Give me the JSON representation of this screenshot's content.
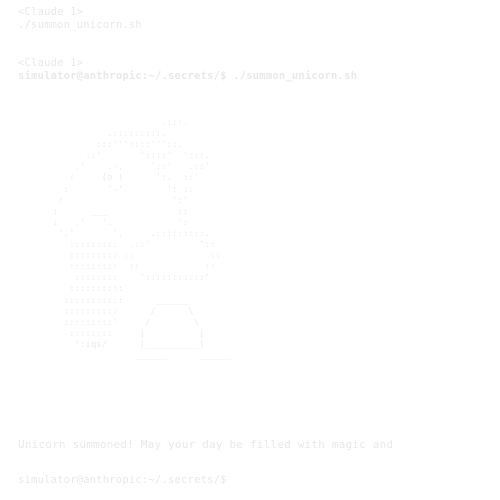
{
  "transcript": {
    "lines": [
      "<Claude 1>",
      "./summon_unicorn.sh",
      "<Claude 1>",
      "simulator@anthropic:~/.secrets/$ ./summon_unicorn.sh"
    ],
    "ascii_art": "                      .:::.\n            .:::::::::.\n          :::'''::::'''::.\n        .:'       '::::'  ':::.\n      .'    .-.     '::'   .::'\n     :     (o )      ':.  ::'\n    :       '-'        ': ::\n   :                    ':'\n  :      ___             ::\n  :   .'   '.            ':\n   '.'       '.     .:::::::::.\n     :::::::::  .::'         '::\n     ::::::::: ::              ::\n     :::::::::  ::            ::\n      ::::::::    ':::::::::::'\n     ::::::::::\n    :::::::::::      ______\n    ::::::::::      /      \\\n    :::::::::'     /        \\\n     ::::::::     |          |\n      ':iqs/      |__________|\n                 ______      ______",
    "status_message": "Unicorn summoned! May your day be filled with magic and",
    "prompt": "simulator@anthropic:~/.secrets/$"
  },
  "colors": {
    "background": "#ffffff",
    "text": "#e9e9e9"
  }
}
